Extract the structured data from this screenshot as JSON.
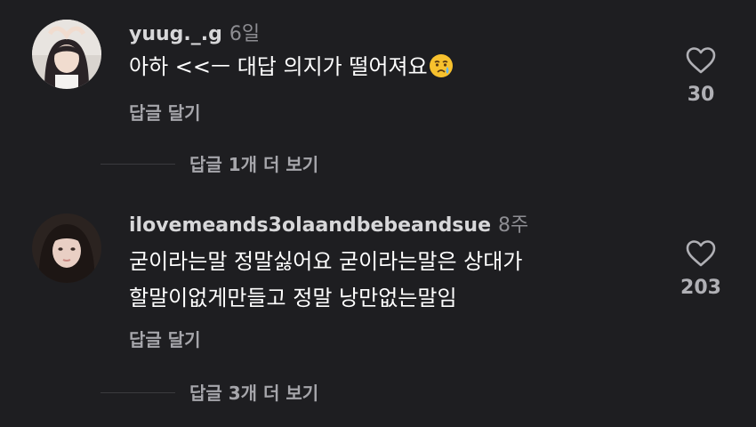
{
  "comments": [
    {
      "username": "yuug._.g",
      "time": "6일",
      "text_lines": [
        "아하 <<ㅡ 대답 의지가 떨어져요"
      ],
      "emoji": "crying-face-emoji",
      "reply_label": "답글 달기",
      "like_count": "30",
      "view_replies_label": "답글 1개 더 보기"
    },
    {
      "username": "ilovemeands3olaandbebeandsue",
      "time": "8주",
      "text_lines": [
        "굳이라는말 정말싫어요 굳이라는말은 상대가",
        "할말이없게만들고 정말 낭만없는말임"
      ],
      "reply_label": "답글 달기",
      "like_count": "203",
      "view_replies_label": "답글 3개 더 보기"
    }
  ],
  "colors": {
    "background": "#1e1e21",
    "text": "#ffffff",
    "muted": "#a6a6ab",
    "timestamp": "#8d8d92"
  }
}
